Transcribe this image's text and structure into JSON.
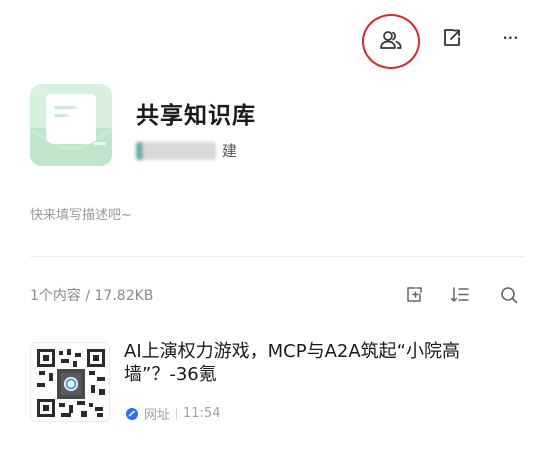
{
  "header": {
    "icons": [
      "members-icon",
      "share-icon",
      "more-icon"
    ],
    "more_label": "···",
    "annotation_color": "#e0262b"
  },
  "library": {
    "title": "共享知识库",
    "creator_suffix": "建",
    "description_placeholder": "快来填写描述吧~",
    "cover_color": "#d6f0de"
  },
  "content_bar": {
    "count_label": "1个内容 / 17.82KB",
    "tools": [
      "add-content-icon",
      "sort-icon",
      "search-icon"
    ]
  },
  "items": [
    {
      "title": "AI上演权力游戏，MCP与A2A筑起“小院高墙”？-36氪",
      "type_label": "网址",
      "time": "11:54",
      "type_color": "#2d6cf6"
    }
  ]
}
